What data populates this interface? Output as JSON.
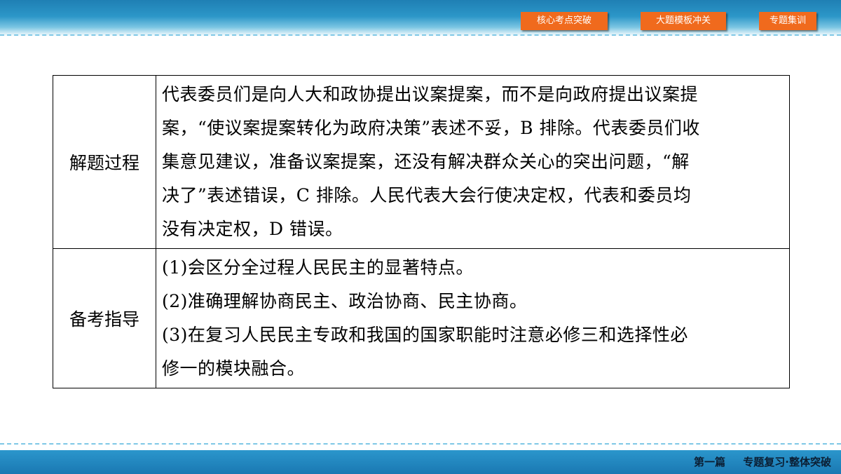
{
  "nav": {
    "buttons": [
      "核心考点突破",
      "大题模板冲关",
      "专题集训"
    ]
  },
  "table": {
    "rows": [
      {
        "label": "解题过程",
        "lines": [
          "代表委员们是向人大和政协提出议案提案，而不是向政府提出议案提",
          "案，“使议案提案转化为政府决策”表述不妥，B 排除。代表委员们收",
          "集意见建议，准备议案提案，还没有解决群众关心的突出问题，“解",
          "决了”表述错误，C 排除。人民代表大会行使决定权，代表和委员均",
          "没有决定权，D 错误。"
        ]
      },
      {
        "label": "备考指导",
        "lines": [
          "(1)会区分全过程人民民主的显著特点。",
          "(2)准确理解协商民主、政治协商、民主协商。",
          "(3)在复习人民民主专政和我国的国家职能时注意必修三和选择性必",
          "修一的模块融合。"
        ]
      }
    ]
  },
  "footer": {
    "part": "第一篇",
    "title": "专题复习·整体突破"
  },
  "colors": {
    "header_blue": "#1f7fb4",
    "nav_orange": "#f06a1d",
    "footer_blue": "#1a78b2"
  }
}
